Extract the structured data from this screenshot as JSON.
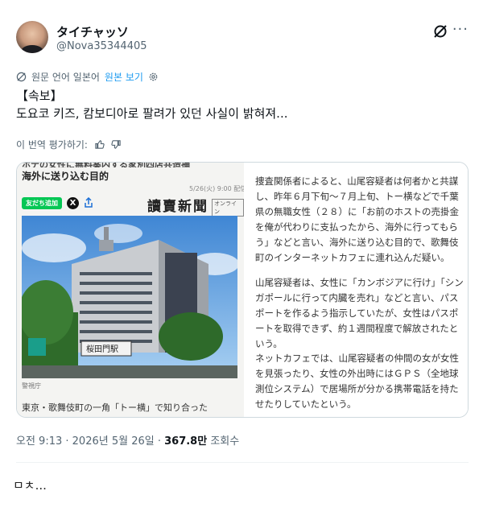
{
  "user": {
    "display_name": "タイチャッソ",
    "handle": "@Nova35344405"
  },
  "icons": {
    "avatar": "avatar-photo",
    "grok": "grok-slash-circle-icon",
    "more": "more-dots-icon",
    "translate": "translate-icon",
    "settings": "gear-icon",
    "like": "thumbs-up-icon",
    "dislike": "thumbs-down-icon"
  },
  "translation": {
    "original_lang_label": "원문 언어 일본어",
    "view_original": "원본 보기",
    "rate_label": "이 번역 평가하기:"
  },
  "tweet": {
    "line1": "【속보】",
    "line2": "도요코 키즈, 캄보디아로 팔려가 있던 사실이 밝혀져..."
  },
  "clip": {
    "cut_top": "ホテの女性に無料案内する家別四店共造捕",
    "headline": "海外に送り込む目的",
    "date": "5/26(火) 9:00 配信",
    "line_btn": "友だち追加",
    "x_btn": "X",
    "logo": "讀賣新聞",
    "online_badge": "オンライン",
    "photo_sign": "桜田門駅",
    "photo_caption": "警視庁",
    "caption": "東京・歌舞伎町の一角「トー横」で知り合った",
    "para1": "捜査関係者によると、山尾容疑者は何者かと共謀し、昨年６月下旬〜７月上旬、トー横などで千葉県の無職女性（２８）に「お前のホストの売掛金を俺が代わりに支払ったから、海外に行ってもらう」などと言い、海外に送り込む目的で、歌舞伎町のインターネットカフェに連れ込んだ疑い。",
    "para2": "山尾容疑者は、女性に「カンボジアに行け」「シンガポールに行って内臓を売れ」などと言い、パスポートを作るよう指示していたが、女性はパスポートを取得できず、約１週間程度で解放されたという。",
    "para3": "ネットカフェでは、山尾容疑者の仲間の女が女性を見張ったり、女性の外出時にはＧＰＳ（全地球測位システム）で居場所が分かる携帯電話を持たせたりしていたという。"
  },
  "meta": {
    "time": "오전 9:13",
    "sep1": " · ",
    "date": "2026년 5월 26일",
    "sep2": " · ",
    "views": "367.8만",
    "views_label": " 조회수"
  },
  "comment": "ㅁㅊ..."
}
